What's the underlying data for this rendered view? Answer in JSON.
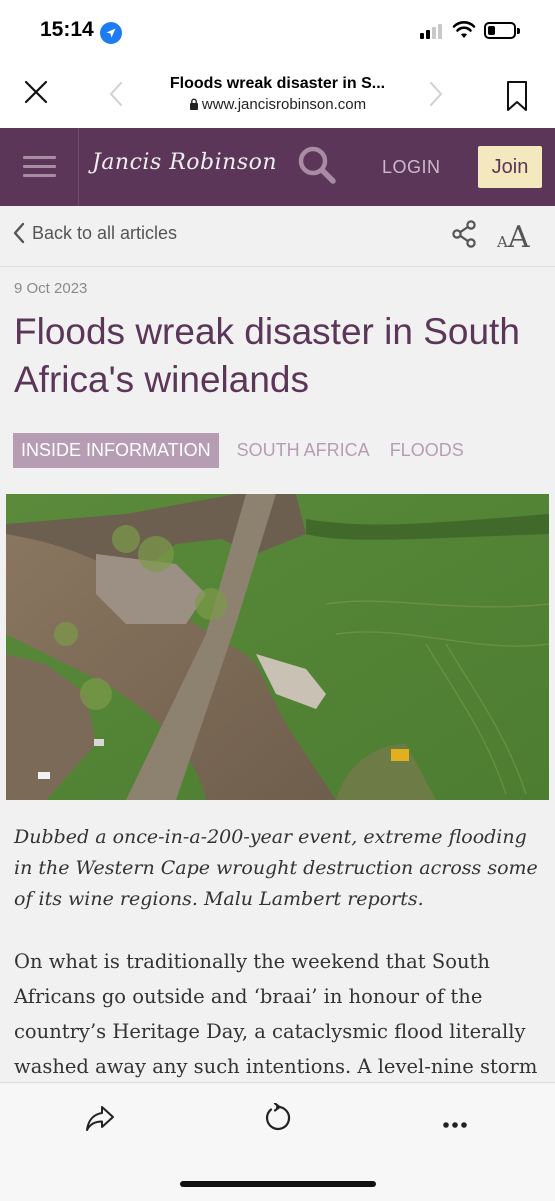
{
  "status": {
    "time": "15:14"
  },
  "browser": {
    "page_title": "Floods wreak disaster in S...",
    "domain": "www.jancisrobinson.com"
  },
  "site": {
    "logo": "Jancis Robinson",
    "login": "LOGIN",
    "join": "Join"
  },
  "article_tools": {
    "back_label": "Back to all articles",
    "text_size_small": "A",
    "text_size_large": "A"
  },
  "article": {
    "date": "9 Oct 2023",
    "headline": "Floods wreak disaster in South Africa's winelands",
    "tags": [
      "INSIDE INFORMATION",
      "SOUTH AFRICA",
      "FLOODS"
    ],
    "standfirst": "Dubbed a once-in-a-200-year event, extreme flooding in the Western Cape wrought destruction across some of its wine regions. Malu Lambert reports.",
    "body": "On what is traditionally the weekend that South Africans go outside and ‘braai’ in honour of the country’s Heritage Day, a cataclysmic flood literally washed away any such intentions. A level-nine storm"
  },
  "colors": {
    "brand": "#5b3658",
    "join_bg": "#f4e8bf",
    "tag": "#b79db4"
  }
}
